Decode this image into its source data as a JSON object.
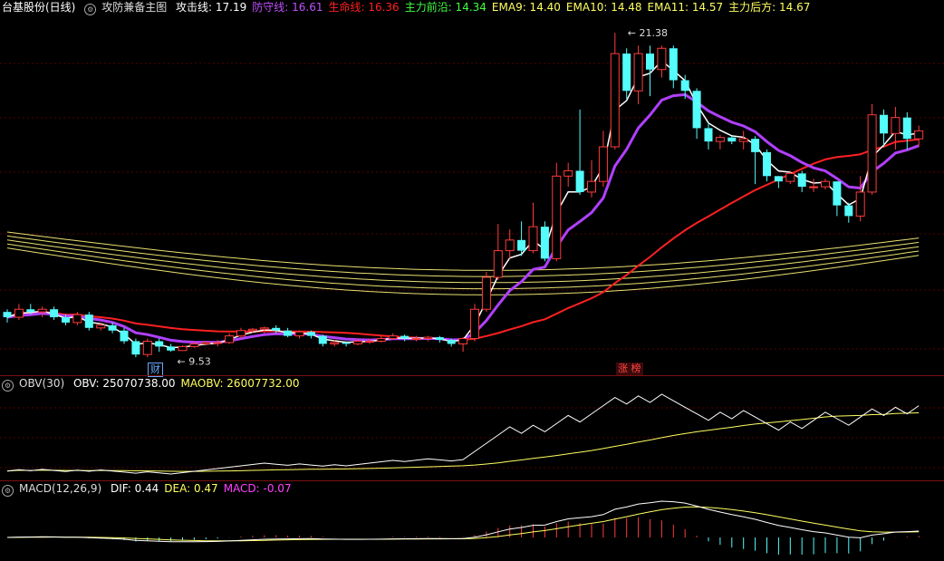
{
  "main": {
    "stock_name": "台基股份(日线)",
    "indicator_name": "攻防兼备主图",
    "legend": [
      {
        "label": "攻击线:",
        "value": "17.19",
        "color": "#ffffff"
      },
      {
        "label": "防守线:",
        "value": "16.61",
        "color": "#c050ff"
      },
      {
        "label": "生命线:",
        "value": "16.36",
        "color": "#ff2020"
      },
      {
        "label": "主力前沿:",
        "value": "14.34",
        "color": "#40ff40"
      },
      {
        "label": "EMA9:",
        "value": "14.40",
        "color": "#ffff60"
      },
      {
        "label": "EMA10:",
        "value": "14.48",
        "color": "#ffff60"
      },
      {
        "label": "EMA11:",
        "value": "14.57",
        "color": "#ffff60"
      },
      {
        "label": "主力后方:",
        "value": "14.67",
        "color": "#ffff60"
      }
    ],
    "high_label": "21.38",
    "low_label": "9.53",
    "badge_cai": "财",
    "badge_zhangting": "涨 榜"
  },
  "obv": {
    "name": "OBV(30)",
    "legend": [
      {
        "label": "OBV:",
        "value": "25070738.00",
        "color": "#ffffff"
      },
      {
        "label": "MAOBV:",
        "value": "26007732.00",
        "color": "#ffff60"
      }
    ]
  },
  "macd": {
    "name": "MACD(12,26,9)",
    "legend": [
      {
        "label": "DIF:",
        "value": "0.44",
        "color": "#ffffff"
      },
      {
        "label": "DEA:",
        "value": "0.47",
        "color": "#ffff60"
      },
      {
        "label": "MACD:",
        "value": "-0.07",
        "color": "#ff40ff"
      }
    ]
  },
  "chart_data": [
    {
      "type": "candlestick",
      "candles": [
        [
          10.9,
          10.7,
          11.0,
          10.5
        ],
        [
          10.7,
          11.0,
          11.2,
          10.6
        ],
        [
          11.0,
          10.9,
          11.2,
          10.8
        ],
        [
          10.9,
          11.0,
          11.1,
          10.7
        ],
        [
          11.0,
          10.7,
          11.1,
          10.6
        ],
        [
          10.7,
          10.5,
          10.8,
          10.4
        ],
        [
          10.5,
          10.8,
          10.9,
          10.4
        ],
        [
          10.8,
          10.3,
          10.9,
          10.2
        ],
        [
          10.3,
          10.4,
          10.5,
          10.2
        ],
        [
          10.4,
          10.2,
          10.5,
          10.1
        ],
        [
          10.2,
          9.8,
          10.3,
          9.7
        ],
        [
          9.8,
          9.3,
          9.9,
          9.2
        ],
        [
          9.3,
          9.8,
          9.9,
          9.2
        ],
        [
          9.8,
          9.6,
          9.9,
          9.4
        ],
        [
          9.6,
          9.45,
          9.7,
          9.4
        ],
        [
          9.45,
          9.6,
          9.65,
          9.53
        ],
        [
          9.6,
          9.7,
          9.8,
          9.55
        ],
        [
          9.7,
          9.75,
          9.8,
          9.65
        ],
        [
          9.75,
          9.75,
          9.85,
          9.6
        ],
        [
          9.75,
          10.0,
          10.1,
          9.7
        ],
        [
          10.0,
          10.2,
          10.3,
          9.9
        ],
        [
          10.2,
          10.25,
          10.3,
          10.1
        ],
        [
          10.25,
          10.3,
          10.35,
          10.1
        ],
        [
          10.3,
          10.2,
          10.4,
          10.1
        ],
        [
          10.2,
          10.0,
          10.3,
          9.95
        ],
        [
          10.0,
          10.15,
          10.2,
          9.9
        ],
        [
          10.15,
          10.0,
          10.2,
          9.9
        ],
        [
          10.0,
          9.7,
          10.05,
          9.6
        ],
        [
          9.7,
          9.75,
          9.85,
          9.6
        ],
        [
          9.75,
          9.7,
          9.8,
          9.6
        ],
        [
          9.7,
          9.8,
          9.9,
          9.65
        ],
        [
          9.8,
          9.8,
          9.9,
          9.7
        ],
        [
          9.8,
          9.9,
          10.0,
          9.75
        ],
        [
          9.9,
          10.0,
          10.1,
          9.85
        ],
        [
          10.0,
          9.9,
          10.05,
          9.8
        ],
        [
          9.9,
          9.9,
          10.0,
          9.8
        ],
        [
          9.9,
          9.95,
          10.0,
          9.8
        ],
        [
          9.95,
          9.85,
          10.0,
          9.75
        ],
        [
          9.85,
          9.7,
          9.9,
          9.6
        ],
        [
          9.7,
          9.9,
          9.95,
          9.4
        ],
        [
          9.9,
          11.0,
          11.2,
          9.8
        ],
        [
          11.0,
          12.2,
          12.4,
          10.9
        ],
        [
          12.2,
          13.2,
          14.2,
          12.1
        ],
        [
          13.2,
          13.6,
          14.0,
          12.9
        ],
        [
          13.6,
          13.2,
          14.3,
          13.0
        ],
        [
          13.2,
          14.1,
          15.0,
          13.1
        ],
        [
          14.1,
          12.9,
          14.3,
          12.8
        ],
        [
          12.9,
          16.0,
          16.5,
          12.8
        ],
        [
          16.0,
          16.2,
          16.5,
          15.6
        ],
        [
          16.2,
          15.4,
          18.5,
          15.3
        ],
        [
          15.4,
          15.8,
          16.6,
          15.2
        ],
        [
          15.8,
          17.1,
          17.7,
          15.6
        ],
        [
          17.1,
          20.6,
          21.38,
          17.0
        ],
        [
          20.6,
          19.2,
          20.8,
          18.9
        ],
        [
          19.2,
          20.6,
          20.9,
          18.7
        ],
        [
          20.6,
          20.0,
          20.9,
          19.0
        ],
        [
          20.0,
          20.8,
          20.9,
          19.7
        ],
        [
          20.8,
          19.6,
          20.9,
          19.3
        ],
        [
          19.6,
          19.2,
          19.8,
          18.9
        ],
        [
          19.2,
          17.8,
          19.3,
          17.4
        ],
        [
          17.8,
          17.3,
          18.0,
          17.0
        ],
        [
          17.3,
          17.45,
          17.55,
          17.0
        ],
        [
          17.45,
          17.3,
          17.5,
          17.2
        ],
        [
          17.3,
          17.4,
          17.7,
          17.0
        ],
        [
          17.4,
          16.9,
          17.5,
          15.7
        ],
        [
          16.9,
          16.0,
          17.0,
          15.8
        ],
        [
          16.0,
          15.8,
          16.0,
          15.55
        ],
        [
          15.8,
          16.1,
          16.2,
          15.7
        ],
        [
          16.1,
          15.6,
          16.2,
          15.4
        ],
        [
          15.6,
          15.6,
          15.9,
          15.4
        ],
        [
          15.6,
          15.8,
          15.9,
          15.5
        ],
        [
          15.8,
          14.9,
          15.8,
          14.5
        ],
        [
          14.9,
          14.5,
          15.0,
          14.25
        ],
        [
          14.5,
          15.4,
          16.0,
          14.3
        ],
        [
          15.4,
          18.3,
          18.7,
          15.3
        ],
        [
          18.3,
          17.6,
          18.5,
          17.1
        ],
        [
          17.6,
          18.2,
          18.6,
          17.0
        ],
        [
          18.2,
          17.4,
          18.4,
          17.0
        ],
        [
          17.4,
          17.7,
          17.9,
          17.1
        ]
      ],
      "price_range": [
        9.0,
        22.0
      ]
    },
    {
      "type": "line",
      "name": "OBV(30)",
      "series": [
        "OBV",
        "MAOBV"
      ]
    },
    {
      "type": "bar",
      "name": "MACD(12,26,9)",
      "series": [
        "DIF",
        "DEA",
        "MACD"
      ]
    }
  ]
}
